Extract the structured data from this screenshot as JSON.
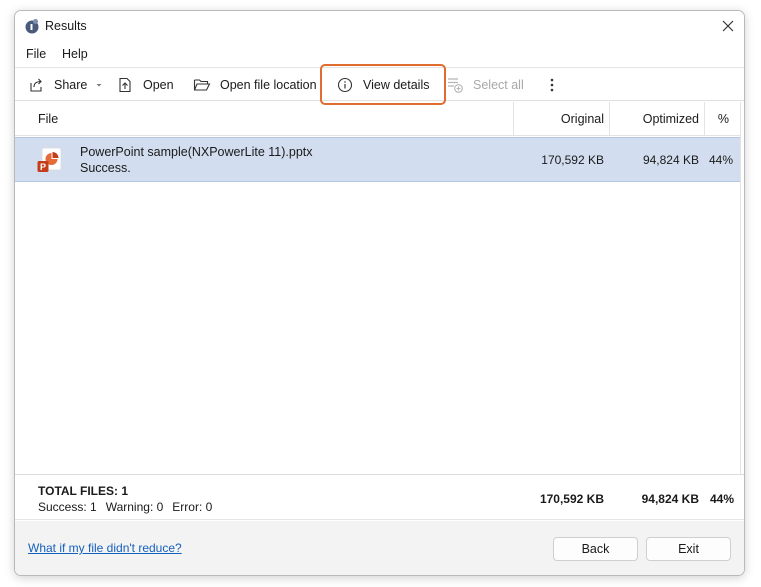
{
  "window": {
    "title": "Results"
  },
  "menu": {
    "items": [
      "File",
      "Help"
    ]
  },
  "toolbar": {
    "share": "Share",
    "open": "Open",
    "open_location": "Open file location",
    "view_details": "View details",
    "select_all": "Select all"
  },
  "columns": {
    "file": "File",
    "original": "Original",
    "optimized": "Optimized",
    "percent": "%"
  },
  "rows": [
    {
      "name": "PowerPoint sample(NXPowerLite 11).pptx",
      "status": "Success.",
      "original": "170,592 KB",
      "optimized": "94,824 KB",
      "percent": "44%"
    }
  ],
  "summary": {
    "title": "TOTAL FILES: 1",
    "success": "Success: 1",
    "warning": "Warning: 0",
    "error": "Error: 0",
    "original": "170,592 KB",
    "optimized": "94,824 KB",
    "percent": "44%"
  },
  "footer": {
    "help_link": "What if my file didn't reduce?",
    "back": "Back",
    "exit": "Exit"
  },
  "colors": {
    "selection": "#d2deef",
    "highlight": "#e06c2f",
    "link": "#1560bd",
    "pptx": "#c43e1c"
  }
}
